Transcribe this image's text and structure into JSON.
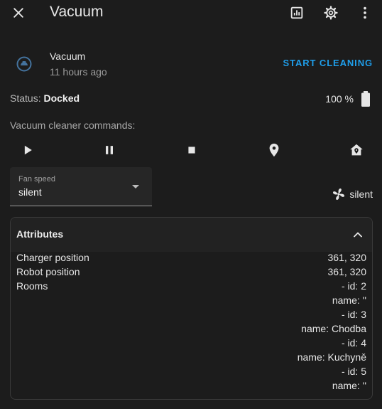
{
  "header": {
    "title": "Vacuum"
  },
  "entity": {
    "name": "Vacuum",
    "last_changed": "11 hours ago",
    "action_label": "START CLEANING"
  },
  "status": {
    "label": "Status: ",
    "value": "Docked",
    "battery": "100 %"
  },
  "commands": {
    "label": "Vacuum cleaner commands:",
    "items": [
      "play-icon",
      "pause-icon",
      "stop-icon",
      "locate-icon",
      "return-home-icon"
    ]
  },
  "fan_speed": {
    "label": "Fan speed",
    "value": "silent",
    "current": "silent"
  },
  "attributes": {
    "title": "Attributes",
    "rows": [
      {
        "key": "Charger position",
        "value": "361, 320"
      },
      {
        "key": "Robot position",
        "value": "361, 320"
      },
      {
        "key": "Rooms",
        "value": "- id: 2"
      }
    ],
    "room_lines": [
      "name: ''",
      "- id: 3",
      "name: Chodba",
      "- id: 4",
      "name: Kuchyně",
      "- id: 5",
      "name: ''"
    ]
  },
  "colors": {
    "accent": "#1f9eea",
    "background": "#1c1c1c"
  }
}
